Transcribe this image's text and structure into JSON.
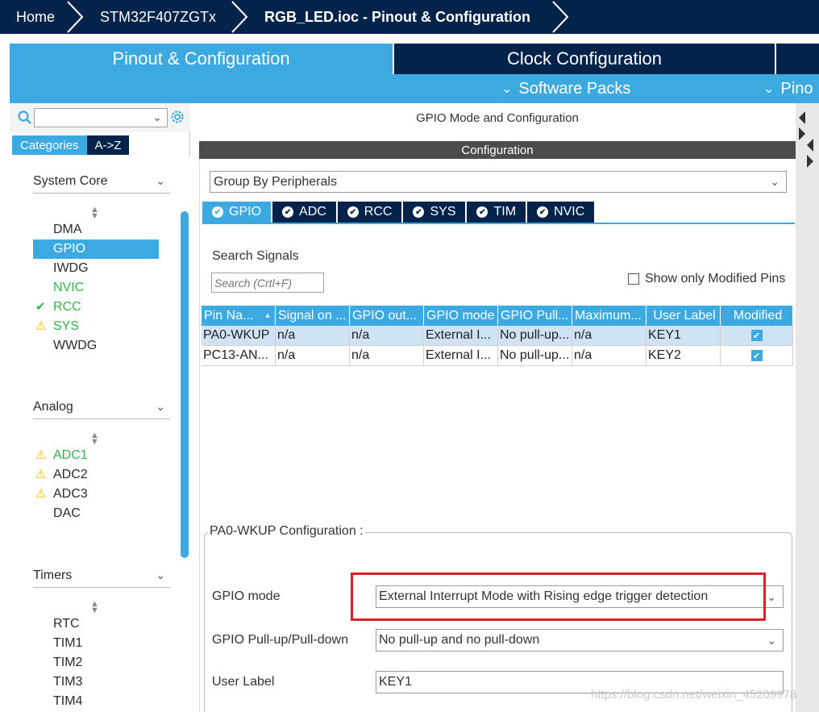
{
  "breadcrumb": {
    "items": [
      "Home",
      "STM32F407ZGTx",
      "RGB_LED.ioc - Pinout & Configuration"
    ]
  },
  "top_tabs": {
    "pinout": "Pinout & Configuration",
    "clock": "Clock Configuration"
  },
  "sub_bar": {
    "software_packs": "Software Packs",
    "pinout": "Pino"
  },
  "left": {
    "tab_categories": "Categories",
    "tab_az": "A->Z",
    "sections": {
      "system_core": {
        "title": "System Core",
        "items": [
          {
            "label": "DMA",
            "status": ""
          },
          {
            "label": "GPIO",
            "status": "selected"
          },
          {
            "label": "IWDG",
            "status": ""
          },
          {
            "label": "NVIC",
            "status": "green"
          },
          {
            "label": "RCC",
            "status": "ok"
          },
          {
            "label": "SYS",
            "status": "warn"
          },
          {
            "label": "WWDG",
            "status": ""
          }
        ]
      },
      "analog": {
        "title": "Analog",
        "items": [
          {
            "label": "ADC1",
            "status": "warn-green"
          },
          {
            "label": "ADC2",
            "status": "warn"
          },
          {
            "label": "ADC3",
            "status": "warn"
          },
          {
            "label": "DAC",
            "status": ""
          }
        ]
      },
      "timers": {
        "title": "Timers",
        "items": [
          {
            "label": "RTC",
            "status": ""
          },
          {
            "label": "TIM1",
            "status": ""
          },
          {
            "label": "TIM2",
            "status": ""
          },
          {
            "label": "TIM3",
            "status": ""
          },
          {
            "label": "TIM4",
            "status": ""
          }
        ]
      }
    }
  },
  "main": {
    "header": "GPIO Mode and Configuration",
    "config_header": "Configuration",
    "group_by": "Group By Peripherals",
    "peripheral_tabs": [
      "GPIO",
      "ADC",
      "RCC",
      "SYS",
      "TIM",
      "NVIC"
    ],
    "search_label": "Search Signals",
    "search_placeholder": "Search (Crtl+F)",
    "show_modified": "Show only Modified Pins",
    "table": {
      "columns": [
        "Pin Na...",
        "Signal on ...",
        "GPIO out...",
        "GPIO mode",
        "GPIO Pull...",
        "Maximum...",
        "User Label",
        "Modified"
      ],
      "rows": [
        [
          "PA0-WKUP",
          "n/a",
          "n/a",
          "External I...",
          "No pull-up...",
          "n/a",
          "KEY1",
          "checked"
        ],
        [
          "PC13-AN...",
          "n/a",
          "n/a",
          "External I...",
          "No pull-up...",
          "n/a",
          "KEY2",
          "checked"
        ]
      ]
    },
    "pin_config": {
      "legend": "PA0-WKUP Configuration :",
      "gpio_mode_label": "GPIO mode",
      "gpio_mode_value": "External Interrupt Mode with Rising edge trigger detection",
      "pull_label": "GPIO Pull-up/Pull-down",
      "pull_value": "No pull-up and no pull-down",
      "user_label_label": "User Label",
      "user_label_value": "KEY1"
    }
  },
  "watermark": "https://blog.csdn.net/weixin_45209978",
  "colors": {
    "navy": "#03234b",
    "accent": "#3ca9e1",
    "highlight": "#d9212a"
  }
}
